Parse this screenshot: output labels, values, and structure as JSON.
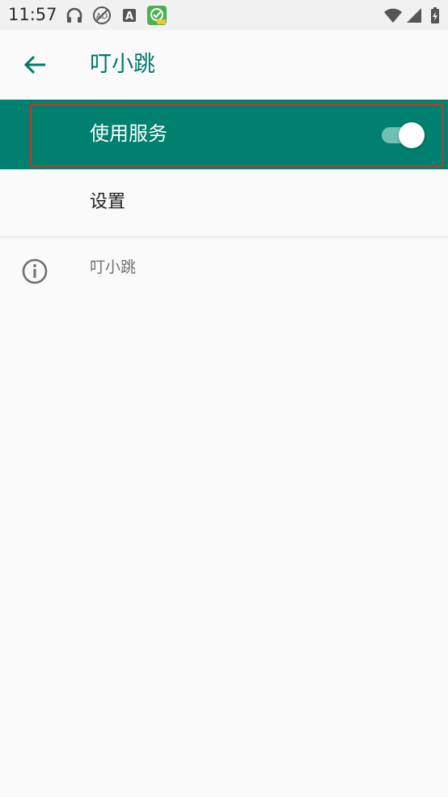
{
  "status_bar": {
    "time": "11:57",
    "left_icons": [
      "headphones-icon",
      "no-ads-icon",
      "font-a-icon",
      "app-notification-icon"
    ],
    "right_icons": [
      "wifi-icon",
      "signal-icon",
      "battery-charging-icon"
    ]
  },
  "app_bar": {
    "back_icon": "arrow-back-icon",
    "title": "叮小跳"
  },
  "main_switch": {
    "label": "使用服务",
    "enabled": true
  },
  "settings": {
    "label": "设置"
  },
  "about": {
    "icon": "info-icon",
    "text": "叮小跳"
  },
  "colors": {
    "accent": "#00806f",
    "title_teal": "#00796b",
    "highlight_border": "#c0392b",
    "background": "#fafafa"
  }
}
